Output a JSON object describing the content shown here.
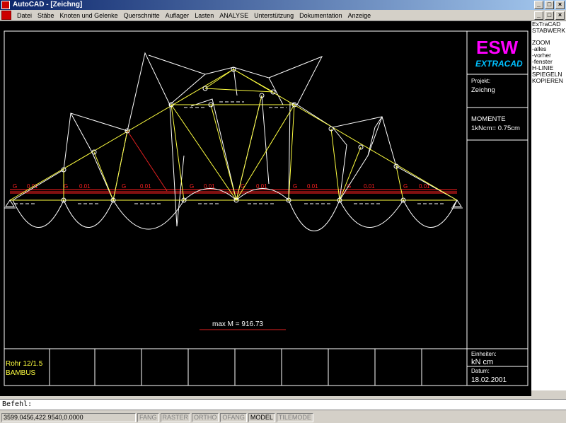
{
  "window": {
    "title": "AutoCAD - [Zeichng]",
    "minimize": "_",
    "maximize": "□",
    "close": "×"
  },
  "menu": [
    "Datei",
    "Stäbe",
    "Knoten und Gelenke",
    "Querschnitte",
    "Auflager",
    "Lasten",
    "ANALYSE",
    "Unterstützung",
    "Dokumentation",
    "Anzeige"
  ],
  "right_menu": {
    "header": [
      "ExTraCAD",
      "STABWERK"
    ],
    "items": [
      "ZOOM",
      "-alles",
      "-vorher",
      "-fenster",
      "H-LINIE",
      "SPIEGELN",
      "KOPIEREN"
    ]
  },
  "logo": {
    "main": "ESW",
    "sub": "EXTRACAD"
  },
  "title_block": {
    "projekt_label": "Projekt:",
    "projekt_value": "Zeichng",
    "momente_label": "MOMENTE",
    "momente_scale": "1kNcm=  0.75cm",
    "einheiten_label": "Einheiten:",
    "einheiten_value": "kN   cm",
    "datum_label": "Datum:",
    "datum_value": "18.02.2001",
    "section1": "Rohr 12/1.5",
    "section2": "BAMBUS"
  },
  "drawing": {
    "max_moment": "max M  =  916.73",
    "load_labels": [
      "G",
      "0.01",
      "G",
      "0.01",
      "G",
      "0.01",
      "G",
      "0.01",
      "G",
      "0.01",
      "G",
      "0.01",
      "G",
      "0.01",
      "G",
      "0.01"
    ]
  },
  "command": {
    "prompt": "Befehl:"
  },
  "status": {
    "coords": "3599.0456,422.9540,0.0000",
    "buttons": [
      {
        "label": "FANG",
        "on": false
      },
      {
        "label": "RASTER",
        "on": false
      },
      {
        "label": "ORTHO",
        "on": false
      },
      {
        "label": "OFANG",
        "on": false
      },
      {
        "label": "MODEL",
        "on": true
      },
      {
        "label": "TILEMODE",
        "on": false
      }
    ]
  },
  "colors": {
    "truss": "#ffff40",
    "moment": "#ffffff",
    "load": "#ff2020",
    "red_diag": "#e02020",
    "logo_main": "#ff00ff",
    "logo_sub": "#00c0ff"
  }
}
